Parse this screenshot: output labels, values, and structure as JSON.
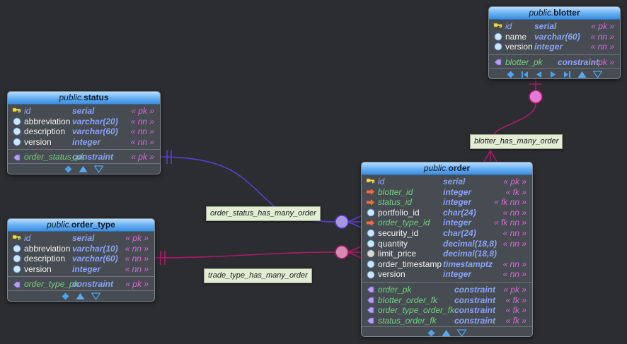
{
  "colors": {
    "background": "#2b2d31",
    "header_gradient_top": "#b9dcff",
    "header_gradient_bottom": "#3d8de0",
    "primary_key_text": "#8ea8f4",
    "foreign_key_text": "#6fd07e",
    "type_text": "#8aa3f8",
    "flag_text": "#d868d8",
    "edge_status": "#5a3fd0",
    "edge_order_type": "#b0186a",
    "edge_blotter": "#b0186a"
  },
  "entities": [
    {
      "id": "blotter",
      "schema": "public.",
      "name": "blotter",
      "columns": [
        {
          "name": "id",
          "type": "serial",
          "flag": "« pk »",
          "kind": "pk"
        },
        {
          "name": "name",
          "type": "varchar(60)",
          "flag": "« nn »",
          "kind": "col"
        },
        {
          "name": "version",
          "type": "integer",
          "flag": "« nn »",
          "kind": "col"
        }
      ],
      "constraints": [
        {
          "name": "blotter_pk",
          "type": "constraint",
          "flag": "« pk »"
        }
      ],
      "footer_icons": [
        "diamond-icon",
        "first-page-icon",
        "prev-page-icon",
        "next-page-icon",
        "last-page-icon",
        "expand-up-icon",
        "collapse-down-icon"
      ]
    },
    {
      "id": "status",
      "schema": "public.",
      "name": "status",
      "columns": [
        {
          "name": "id",
          "type": "serial",
          "flag": "« pk »",
          "kind": "pk"
        },
        {
          "name": "abbreviation",
          "type": "varchar(20)",
          "flag": "« nn »",
          "kind": "col"
        },
        {
          "name": "description",
          "type": "varchar(60)",
          "flag": "« nn »",
          "kind": "col"
        },
        {
          "name": "version",
          "type": "integer",
          "flag": "« nn »",
          "kind": "col"
        }
      ],
      "constraints": [
        {
          "name": "order_status_pk",
          "type": "constraint",
          "flag": "« pk »"
        }
      ],
      "footer_icons": [
        "diamond-icon",
        "expand-up-icon",
        "collapse-down-icon"
      ]
    },
    {
      "id": "order_type",
      "schema": "public.",
      "name": "order_type",
      "columns": [
        {
          "name": "id",
          "type": "serial",
          "flag": "« pk »",
          "kind": "pk"
        },
        {
          "name": "abbreviation",
          "type": "varchar(10)",
          "flag": "« nn »",
          "kind": "col"
        },
        {
          "name": "description",
          "type": "varchar(60)",
          "flag": "« nn »",
          "kind": "col"
        },
        {
          "name": "version",
          "type": "integer",
          "flag": "« nn »",
          "kind": "col"
        }
      ],
      "constraints": [
        {
          "name": "order_type_pk",
          "type": "constraint",
          "flag": "« pk »"
        }
      ],
      "footer_icons": [
        "diamond-icon",
        "expand-up-icon",
        "collapse-down-icon"
      ]
    },
    {
      "id": "order",
      "schema": "public.",
      "name": "order",
      "columns": [
        {
          "name": "id",
          "type": "serial",
          "flag": "« pk »",
          "kind": "pk"
        },
        {
          "name": "blotter_id",
          "type": "integer",
          "flag": "« fk »",
          "kind": "fk"
        },
        {
          "name": "status_id",
          "type": "integer",
          "flag": "« fk nn »",
          "kind": "fk"
        },
        {
          "name": "portfolio_id",
          "type": "char(24)",
          "flag": "« nn »",
          "kind": "col"
        },
        {
          "name": "order_type_id",
          "type": "integer",
          "flag": "« fk nn »",
          "kind": "fk"
        },
        {
          "name": "security_id",
          "type": "char(24)",
          "flag": "« nn »",
          "kind": "col"
        },
        {
          "name": "quantity",
          "type": "decimal(18,8)",
          "flag": "« nn »",
          "kind": "col"
        },
        {
          "name": "limit_price",
          "type": "decimal(18,8)",
          "flag": "",
          "kind": "nullable"
        },
        {
          "name": "order_timestamp",
          "type": "timestamptz",
          "flag": "« nn »",
          "kind": "col"
        },
        {
          "name": "version",
          "type": "integer",
          "flag": "« nn »",
          "kind": "col"
        }
      ],
      "constraints": [
        {
          "name": "order_pk",
          "type": "constraint",
          "flag": "« pk »"
        },
        {
          "name": "blotter_order_fk",
          "type": "constraint",
          "flag": "« fk »"
        },
        {
          "name": "order_type_order_fk",
          "type": "constraint",
          "flag": "« fk »"
        },
        {
          "name": "status_order_fk",
          "type": "constraint",
          "flag": "« fk »"
        }
      ],
      "footer_icons": [
        "diamond-icon",
        "expand-up-icon",
        "collapse-down-icon"
      ]
    }
  ],
  "relationships": [
    {
      "id": "blotter_has_many_order",
      "label": "blotter_has_many_order",
      "color": "#b0186a"
    },
    {
      "id": "order_status_has_many_order",
      "label": "order_status_has_many_order",
      "color": "#5a3fd0"
    },
    {
      "id": "trade_type_has_many_order",
      "label": "trade_type_has_many_order",
      "color": "#b0186a"
    }
  ]
}
